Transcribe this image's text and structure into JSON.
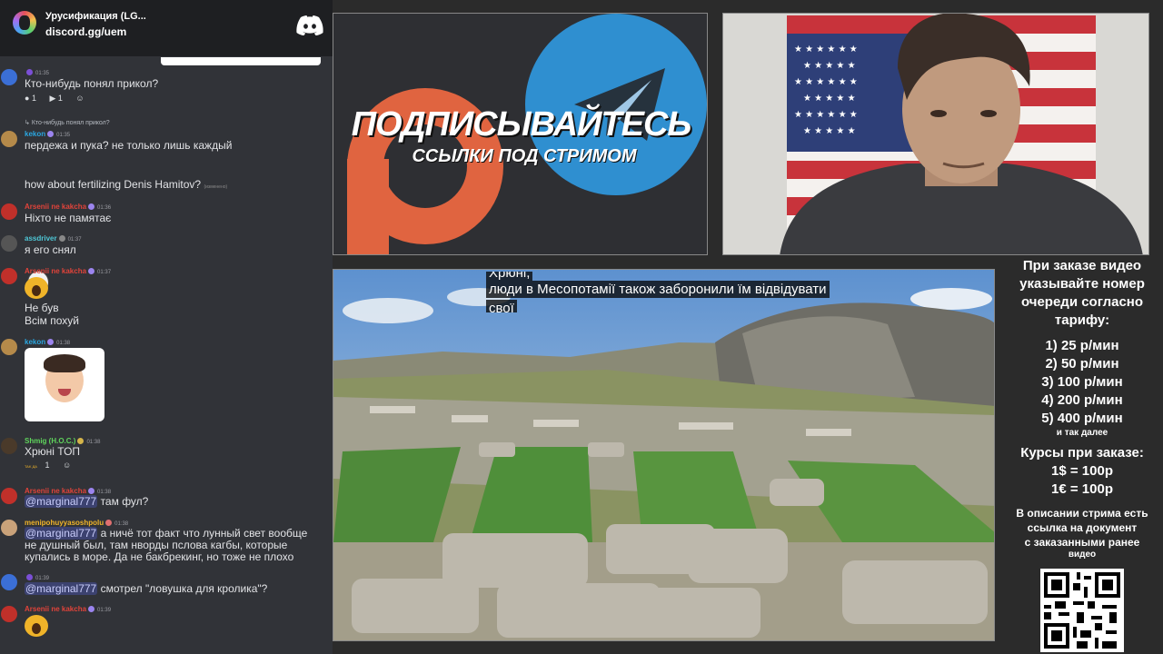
{
  "discord": {
    "server_name": "Урусификация (LG...",
    "invite": "discord.gg/uem"
  },
  "chat": {
    "messages": [
      {
        "time": "01:35",
        "text": "Кто-нибудь понял прикол?",
        "reactions": [
          "1",
          "1"
        ]
      },
      {
        "reply_to": "Кто-нибудь понял прикол?",
        "user": "kekon",
        "time": "01:35",
        "lines": [
          "пердежа и пука? не только лишь каждый",
          "how about fertilizing Denis Hamitov?"
        ],
        "edited": "(изменено)"
      },
      {
        "user": "Arsenii ne kakcha",
        "time": "01:36",
        "text": "Ніхто не памятає"
      },
      {
        "user": "assdriver",
        "time": "01:37",
        "text": "я его снял"
      },
      {
        "user": "Arsenii ne kakcha",
        "time": "01:37",
        "lines": [
          "Не був",
          "Всім похуй"
        ]
      },
      {
        "user": "kekon",
        "time": "01:38"
      },
      {
        "user": "Shmig (H.O.C.)",
        "time": "01:38",
        "text": "Хрюні ТОП",
        "reactions": [
          "1"
        ],
        "reaction_emoji": "TAK ДА"
      },
      {
        "user": "Arsenii ne kakcha",
        "time": "01:38",
        "mention": "@marginal777",
        "text": " там фул?"
      },
      {
        "user": "menipohuyyasoshpolu",
        "time": "01:38",
        "mention": "@marginal777",
        "text": " а ничё тот факт что лунный свет вообще",
        "lines": [
          "не душный был, там нворды пслова кагбы, которые",
          "купались в море. Да не бакбрекинг, но тоже не плохо"
        ]
      },
      {
        "time": "01:39",
        "mention": "@marginal777",
        "text": " смотрел \"ловушка для кролика\"?"
      },
      {
        "user": "Arsenii ne kakcha",
        "time": "01:39"
      }
    ]
  },
  "promo": {
    "title": "ПОДПИСЫВАЙТЕСЬ",
    "subtitle": "ССЫЛКИ ПОД СТРИМОМ"
  },
  "video": {
    "subtitle_top": "Хрюні,",
    "subtitle_line1": "люди в Месопотамії також заборонили їм відвідувати",
    "subtitle_line2": "свої"
  },
  "prices": {
    "header": [
      "При заказе видео",
      "указывайте номер",
      "очереди согласно",
      "тарифу:"
    ],
    "tiers": [
      "1) 25 р/мин",
      "2) 50 р/мин",
      "3) 100 р/мин",
      "4) 200 р/мин",
      "5) 400 р/мин"
    ],
    "etc": "и так далее",
    "rates_title": "Курсы при заказе:",
    "rates": [
      "1$ = 100р",
      "1€ = 100р"
    ],
    "note": [
      "В описании стрима есть",
      "ссылка на документ",
      "с заказанными ранее",
      "видео"
    ]
  },
  "colors": {
    "chat_bg": "#313338",
    "discord_bar": "#1e1f22",
    "telegram_blue": "#2f8fd0",
    "patreon_orange": "#e06440",
    "user_kekon": "#2aa6e0",
    "user_arsenii": "#e0433a",
    "user_assdriver": "#4ec7d6",
    "user_shmig": "#5fd35c",
    "user_menipo": "#f0b429"
  }
}
